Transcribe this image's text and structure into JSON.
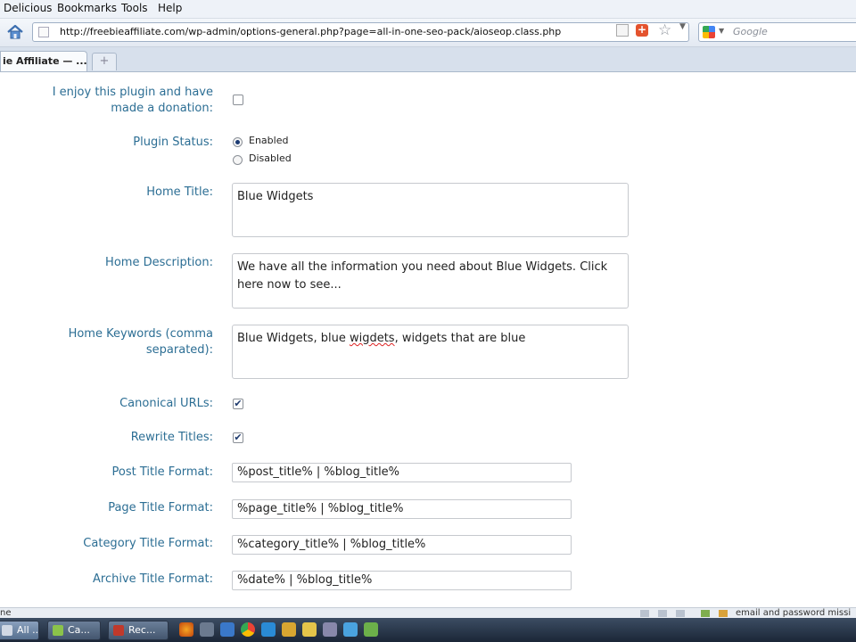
{
  "menu": {
    "delicious": "Delicious",
    "bookmarks": "Bookmarks",
    "tools": "Tools",
    "help": "Help"
  },
  "nav": {
    "url": "http://freebieaffiliate.com/wp-admin/options-general.php?page=all-in-one-seo-pack/aioseop.class.php",
    "search_placeholder": "Google"
  },
  "tabs": {
    "active_label": "ie Affiliate — ...",
    "new_tab": "+"
  },
  "form": {
    "donation_label_1": "I enjoy this plugin and have",
    "donation_label_2": "made a donation:",
    "donation_checked": false,
    "status_label": "Plugin Status:",
    "status_enabled": "Enabled",
    "status_disabled": "Disabled",
    "status_value": "Enabled",
    "home_title_label": "Home Title:",
    "home_title_value": "Blue Widgets",
    "home_desc_label": "Home Description:",
    "home_desc_value": "We have all the information you need about Blue Widgets. Click here now to see...",
    "home_kw_label_1": "Home Keywords (comma",
    "home_kw_label_2": "separated):",
    "home_kw_part1": "Blue Widgets, blue ",
    "home_kw_misspelled": "wigdets",
    "home_kw_part2": ", widgets that are blue",
    "canonical_label": "Canonical URLs:",
    "canonical_checked": true,
    "rewrite_label": "Rewrite Titles:",
    "rewrite_checked": true,
    "post_title_label": "Post Title Format:",
    "post_title_value": "%post_title% | %blog_title%",
    "page_title_label": "Page Title Format:",
    "page_title_value": "%page_title% | %blog_title%",
    "category_title_label": "Category Title Format:",
    "category_title_value": "%category_title% | %blog_title%",
    "archive_title_label": "Archive Title Format:",
    "archive_title_value": "%date% | %blog_title%"
  },
  "status": {
    "left": "ne",
    "right": "email and password missi"
  },
  "taskbar": {
    "btn1": "All ...",
    "btn2": "Ca...",
    "btn3": "Rec..."
  },
  "colors": {
    "label": "#2c6e94",
    "check": "#1e3a6e"
  }
}
